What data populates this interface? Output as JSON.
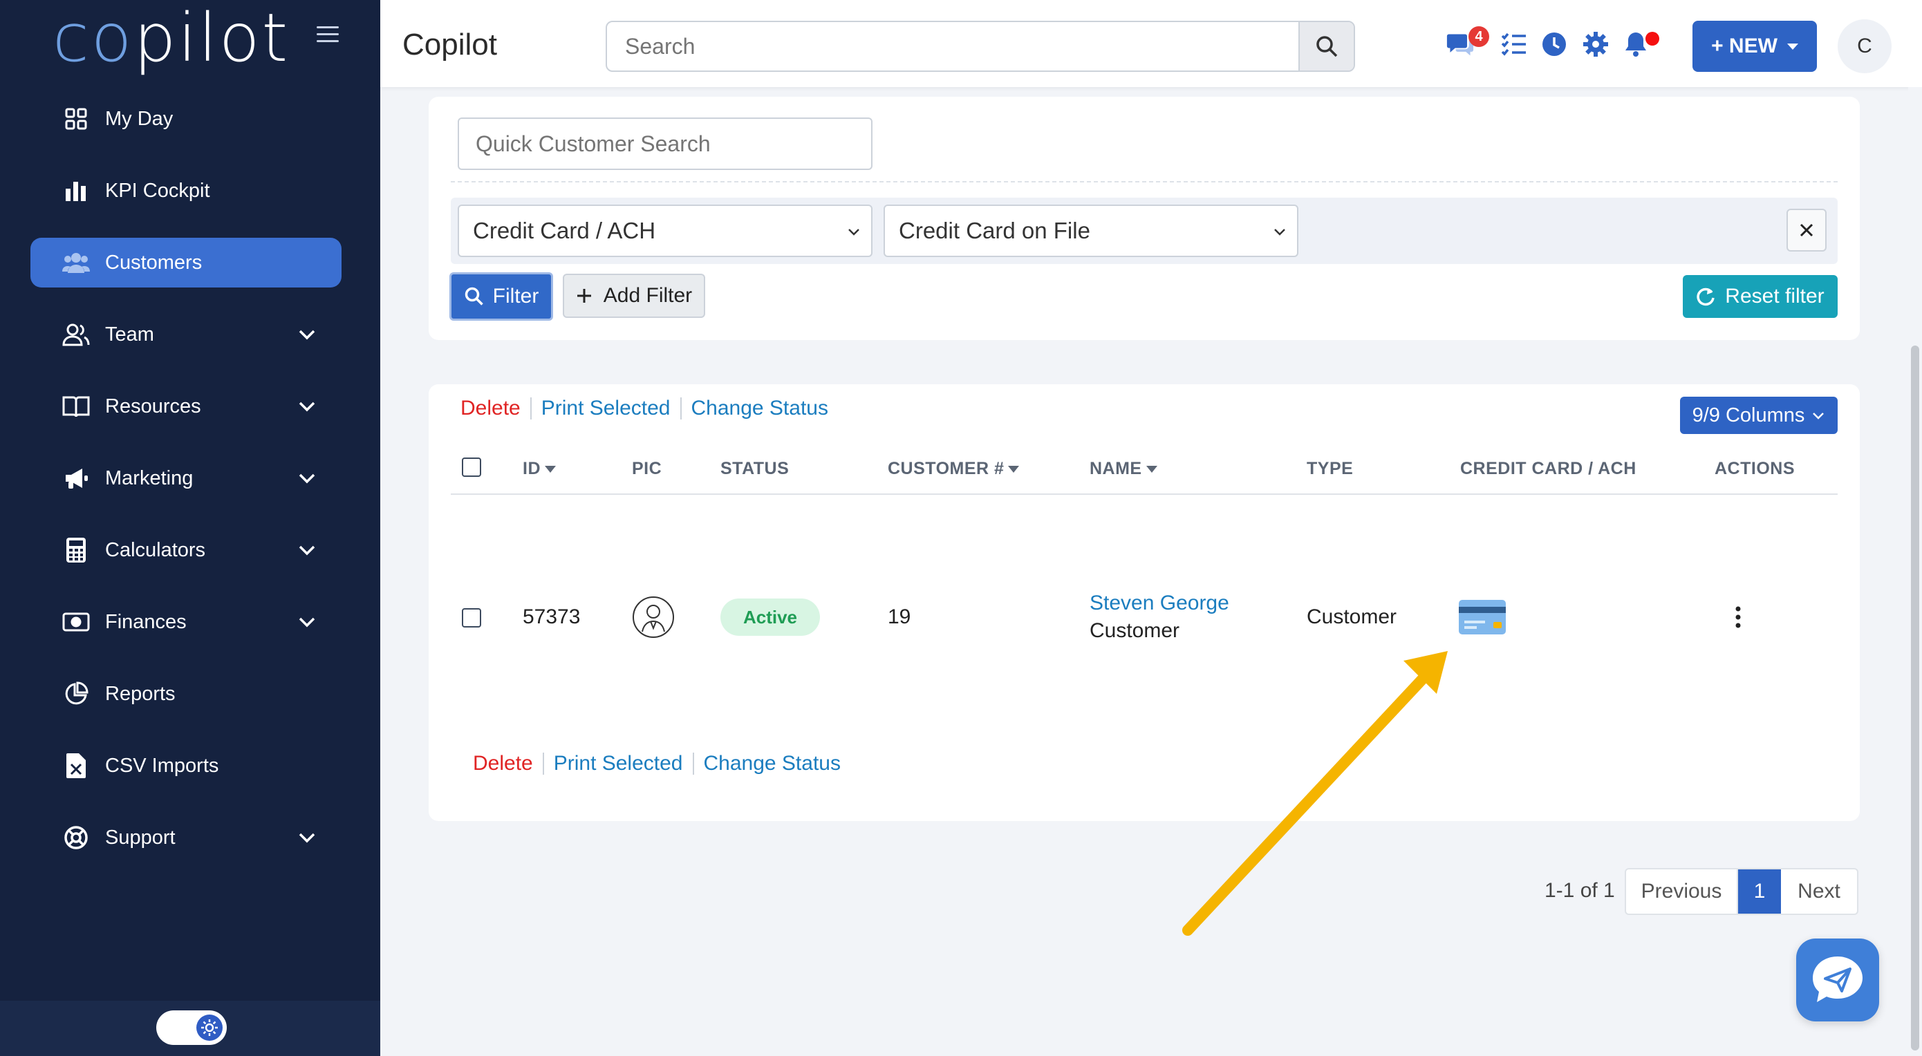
{
  "brand": {
    "logo_part1": "co",
    "logo_part2": "pilot"
  },
  "sidebar": {
    "items": [
      {
        "label": "My Day",
        "icon": "grid-icon"
      },
      {
        "label": "KPI Cockpit",
        "icon": "bar-chart-icon"
      },
      {
        "label": "Customers",
        "icon": "users-icon",
        "active": true
      },
      {
        "label": "Team",
        "icon": "team-icon",
        "expandable": true
      },
      {
        "label": "Resources",
        "icon": "book-icon",
        "expandable": true
      },
      {
        "label": "Marketing",
        "icon": "megaphone-icon",
        "expandable": true
      },
      {
        "label": "Calculators",
        "icon": "calculator-icon",
        "expandable": true
      },
      {
        "label": "Finances",
        "icon": "money-icon",
        "expandable": true
      },
      {
        "label": "Reports",
        "icon": "pie-chart-icon"
      },
      {
        "label": "CSV Imports",
        "icon": "file-excel-icon"
      },
      {
        "label": "Support",
        "icon": "life-ring-icon",
        "expandable": true
      }
    ]
  },
  "header": {
    "title": "Copilot",
    "search_placeholder": "Search",
    "messages_badge": "4",
    "new_label": "+ NEW",
    "avatar_initial": "C"
  },
  "filters": {
    "quick_search_placeholder": "Quick Customer Search",
    "field_select": "Credit Card / ACH",
    "value_select": "Credit Card on File",
    "filter_label": "Filter",
    "add_filter_label": "Add Filter",
    "reset_label": "Reset filter"
  },
  "table": {
    "bulk_actions": {
      "delete": "Delete",
      "print": "Print Selected",
      "change_status": "Change Status"
    },
    "columns_button": "9/9 Columns",
    "headers": {
      "id": "ID",
      "pic": "PIC",
      "status": "STATUS",
      "customer_no": "CUSTOMER #",
      "name": "NAME",
      "type": "TYPE",
      "credit_card": "CREDIT CARD / ACH",
      "actions": "ACTIONS"
    },
    "rows": [
      {
        "id": "57373",
        "status": "Active",
        "customer_no": "19",
        "name": "Steven George",
        "name_sub": "Customer",
        "type": "Customer"
      }
    ]
  },
  "pagination": {
    "info": "1-1 of 1",
    "previous": "Previous",
    "current": "1",
    "next": "Next"
  },
  "colors": {
    "sidebar_bg": "#15223f",
    "accent": "#2e63c4",
    "teal": "#17a2b8",
    "danger": "#e02424",
    "link": "#1b7dbf",
    "annotation_arrow": "#f5b400"
  }
}
